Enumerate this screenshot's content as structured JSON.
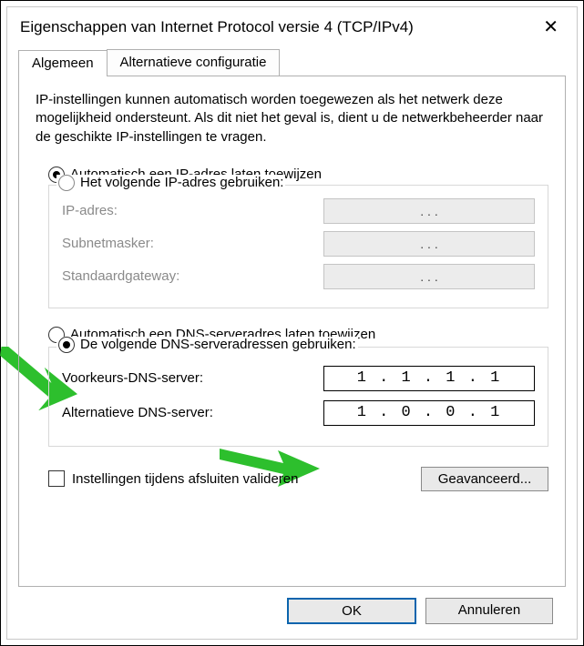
{
  "title": "Eigenschappen van Internet Protocol versie 4 (TCP/IPv4)",
  "tabs": {
    "general": "Algemeen",
    "alt": "Alternatieve configuratie"
  },
  "intro": "IP-instellingen kunnen automatisch worden toegewezen als het netwerk deze mogelijkheid ondersteunt. Als dit niet het geval is, dient u de netwerkbeheerder naar de geschikte IP-instellingen te vragen.",
  "ip": {
    "auto": "Automatisch een IP-adres laten toewijzen",
    "manual": "Het volgende IP-adres gebruiken:",
    "fields": {
      "address": "IP-adres:",
      "mask": "Subnetmasker:",
      "gateway": "Standaardgateway:"
    },
    "placeholder": ".       .       ."
  },
  "dns": {
    "auto": "Automatisch een DNS-serveradres laten toewijzen",
    "manual": "De volgende DNS-serveradressen gebruiken:",
    "preferred_label": "Voorkeurs-DNS-server:",
    "alternate_label": "Alternatieve DNS-server:",
    "preferred_value": "1 . 1 . 1 . 1",
    "alternate_value": "1 . 0 . 0 . 1"
  },
  "validate": "Instellingen tijdens afsluiten valideren",
  "advanced": "Geavanceerd...",
  "ok": "OK",
  "cancel": "Annuleren"
}
